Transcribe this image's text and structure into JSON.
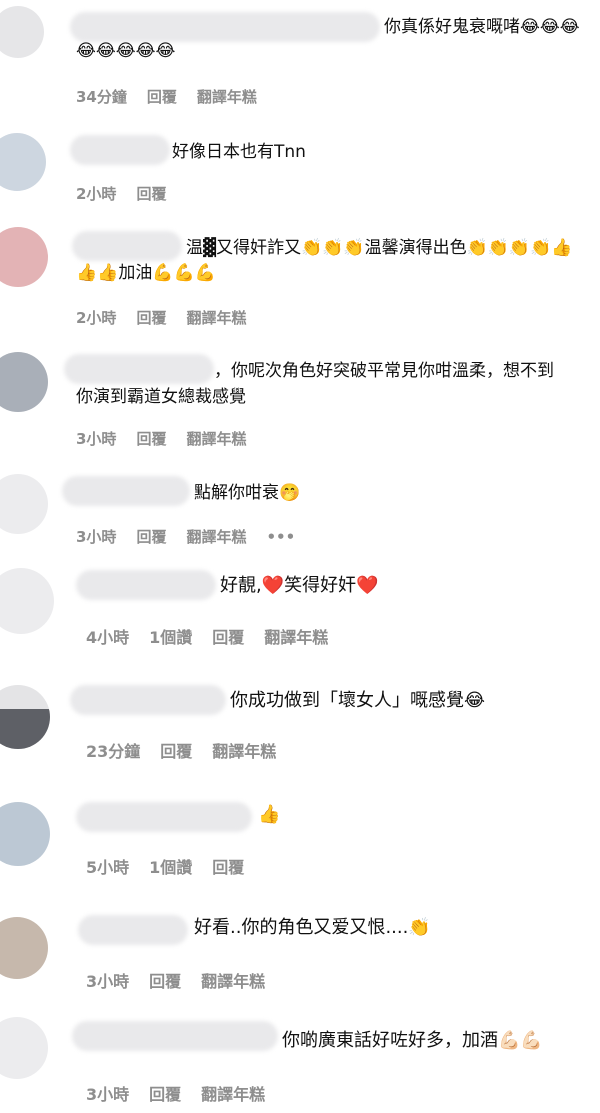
{
  "comments": [
    {
      "text1": "你真係好鬼衰嘅啫😂😂😂",
      "text2": "😂😂😂😂😂",
      "time": "34分鐘",
      "reply": "回覆",
      "translate": "翻譯年糕"
    },
    {
      "text1": "好像日本也有Tnn",
      "time": "2小時",
      "reply": "回覆"
    },
    {
      "text1": "温▓又得奸詐又👏👏👏温馨演得出色👏👏👏👏👍",
      "text2": "👍👍加油💪💪💪",
      "time": "2小時",
      "reply": "回覆",
      "translate": "翻譯年糕"
    },
    {
      "text1": "，你呢次角色好突破平常見你咁溫柔，想不到",
      "text2": "你演到霸道女總裁感覺",
      "time": "3小時",
      "reply": "回覆",
      "translate": "翻譯年糕"
    },
    {
      "text1": "點解你咁衰🤭",
      "time": "3小時",
      "reply": "回覆",
      "translate": "翻譯年糕",
      "more": "•••"
    },
    {
      "text1": "好靚,❤️笑得好奸❤️",
      "time": "4小時",
      "likes": "1個讚",
      "reply": "回覆",
      "translate": "翻譯年糕"
    },
    {
      "text1": "你成功做到「壞女人」嘅感覺😂",
      "time": "23分鐘",
      "reply": "回覆",
      "translate": "翻譯年糕"
    },
    {
      "text1": "👍",
      "time": "5小時",
      "likes": "1個讚",
      "reply": "回覆"
    },
    {
      "text1": "好看..你的角色又爱又恨....👏",
      "time": "3小時",
      "reply": "回覆",
      "translate": "翻譯年糕"
    },
    {
      "text1": "你啲廣東話好咗好多，加酒💪🏻💪🏻",
      "time": "3小時",
      "reply": "回覆",
      "translate": "翻譯年糕"
    }
  ],
  "colors": {
    "meta": "#8e8e8e",
    "blur": "#e9e9eb"
  }
}
